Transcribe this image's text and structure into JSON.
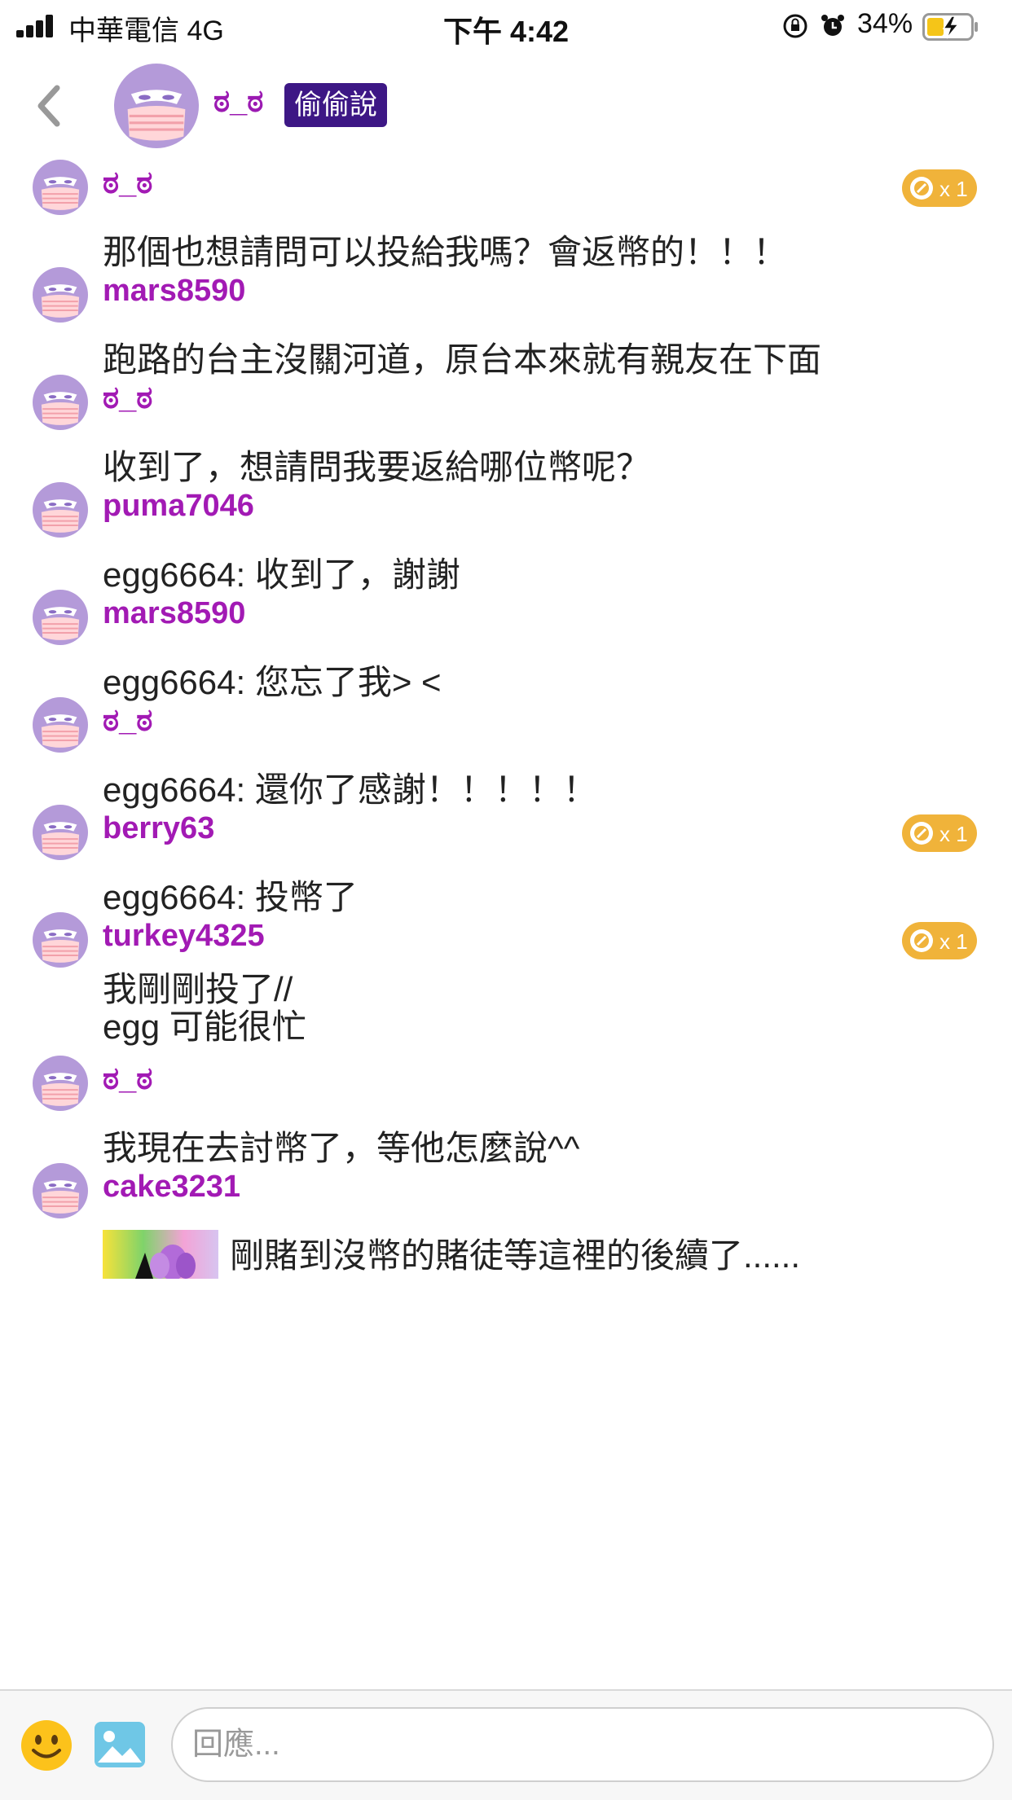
{
  "status_bar": {
    "carrier": "中華電信   4G",
    "time": "下午 4:42",
    "battery": "34%"
  },
  "header": {
    "name": "ಠ_ಠ",
    "badge": "偷偷說"
  },
  "messages": [
    {
      "user": "ಠ_ಠ",
      "lines": [
        "那個也想請問可以投給我嗎？會返幣的！！！"
      ],
      "coin": "x 1"
    },
    {
      "user": "mars8590",
      "lines": [
        "跑路的台主沒關河道，原台本來就有親友在下面"
      ]
    },
    {
      "user": "ಠ_ಠ",
      "lines": [
        "收到了，想請問我要返給哪位幣呢？"
      ]
    },
    {
      "user": "puma7046",
      "lines": [
        "egg6664: 收到了，謝謝"
      ]
    },
    {
      "user": "mars8590",
      "lines": [
        "egg6664: 您忘了我> <"
      ]
    },
    {
      "user": "ಠ_ಠ",
      "lines": [
        "egg6664: 還你了感謝！！！！！"
      ]
    },
    {
      "user": "berry63",
      "lines": [
        "egg6664: 投幣了"
      ],
      "coin": "x 1"
    },
    {
      "user": "turkey4325",
      "lines": [
        "我剛剛投了//",
        "egg 可能很忙"
      ],
      "coin": "x 1"
    },
    {
      "user": "ಠ_ಠ",
      "lines": [
        "我現在去討幣了，等他怎麼說^^"
      ]
    },
    {
      "user": "cake3231",
      "lines": [
        "剛賭到沒幣的賭徒等這裡的後續了......"
      ],
      "has_image": true
    }
  ],
  "input": {
    "placeholder": "回應..."
  },
  "colors": {
    "username": "#a21ab4",
    "badge_bg": "#3d1785",
    "coin_badge": "#f0b33a",
    "avatar": "#b49ad9"
  },
  "icons": [
    "back-chevron-icon",
    "masked-avatar-icon",
    "coin-icon",
    "emoji-icon",
    "image-icon",
    "lock-rotation-icon",
    "alarm-icon",
    "battery-charging-icon"
  ]
}
